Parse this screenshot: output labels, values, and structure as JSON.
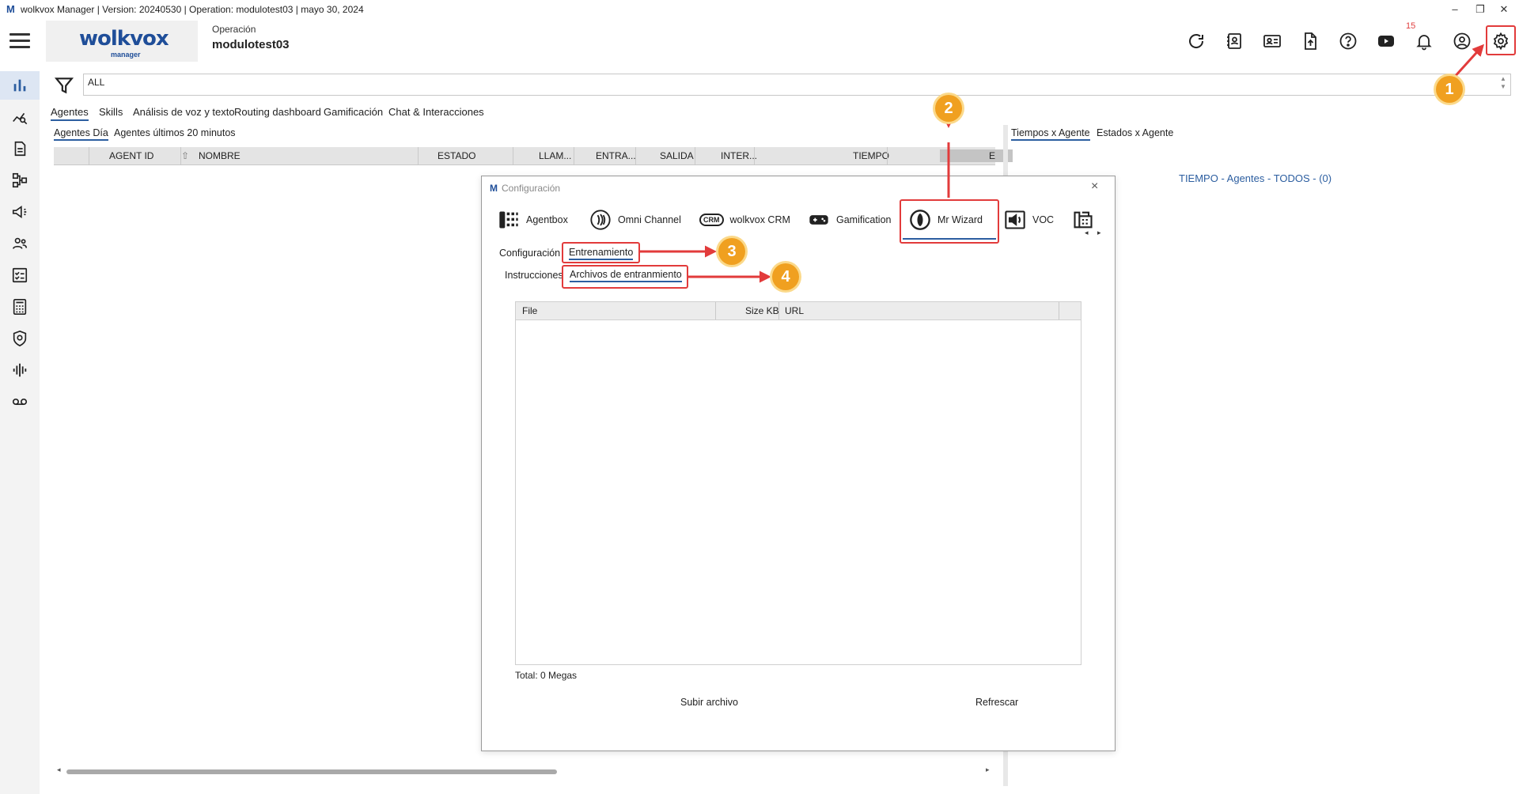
{
  "window": {
    "title": "wolkvox Manager  | Version: 20240530 |  Operation: modulotest03 | mayo 30, 2024",
    "logo_letter": "M",
    "controls": [
      "–",
      "❐",
      "✕"
    ]
  },
  "header": {
    "logo_word": "wolkvox",
    "logo_sub": "manager",
    "operation_label": "Operación",
    "operation_name": "modulotest03",
    "notification_count": "15",
    "icons": [
      "refresh-icon",
      "contacts-book-icon",
      "id-card-icon",
      "upload-file-icon",
      "help-icon",
      "video-icon",
      "bell-icon",
      "user-icon",
      "gear-icon"
    ]
  },
  "rail": {
    "icons": [
      "bar-chart-icon",
      "analytics-icon",
      "report-icon",
      "flow-icon",
      "campaign-icon",
      "users-icon",
      "checklist-icon",
      "calculator-icon",
      "shield-icon",
      "audio-wave-icon",
      "voicemail-icon"
    ]
  },
  "filter": {
    "value": "ALL"
  },
  "tabs": [
    {
      "label": "Agentes",
      "active": true
    },
    {
      "label": "Skills"
    },
    {
      "label": "Análisis de voz y texto"
    },
    {
      "label": "Routing dashboard"
    },
    {
      "label": "Gamificación"
    },
    {
      "label": "Chat & Interacciones"
    }
  ],
  "subtabs": [
    {
      "label": "Agentes Día",
      "active": true
    },
    {
      "label": "Agentes últimos 20 minutos"
    }
  ],
  "grid": {
    "columns": [
      "AGENT ID",
      "NOMBRE",
      "ESTADO",
      "LLAM...",
      "ENTRA...",
      "SALIDA",
      "INTER...",
      "TIEMPO",
      "E"
    ],
    "sort_indicator": "⇧"
  },
  "right_panel": {
    "tabs": [
      "Tiempos x Agente",
      "Estados x Agente"
    ],
    "title": "TIEMPO - Agentes - TODOS -  (0)"
  },
  "dialog": {
    "logo_letter": "M",
    "title": "Configuración",
    "close": "×",
    "tabs": [
      "Agentbox",
      "Omni Channel",
      "wolkvox CRM",
      "Gamification",
      "Mr Wizard",
      "VOC"
    ],
    "crm_badge": "CRM",
    "row1": {
      "label": "Configuración",
      "active_tab": "Entrenamiento"
    },
    "row2": {
      "label": "Instrucciones",
      "active_tab": "Archivos de entranmiento"
    },
    "files_columns": [
      "File",
      "Size KB",
      "URL"
    ],
    "total": "Total: 0 Megas",
    "buttons": {
      "upload": "Subir archivo",
      "refresh": "Refrescar"
    }
  },
  "annotations": {
    "badges": [
      "1",
      "2",
      "3",
      "4"
    ],
    "accent": "#e23b3b",
    "badge_color": "#f0a020"
  }
}
